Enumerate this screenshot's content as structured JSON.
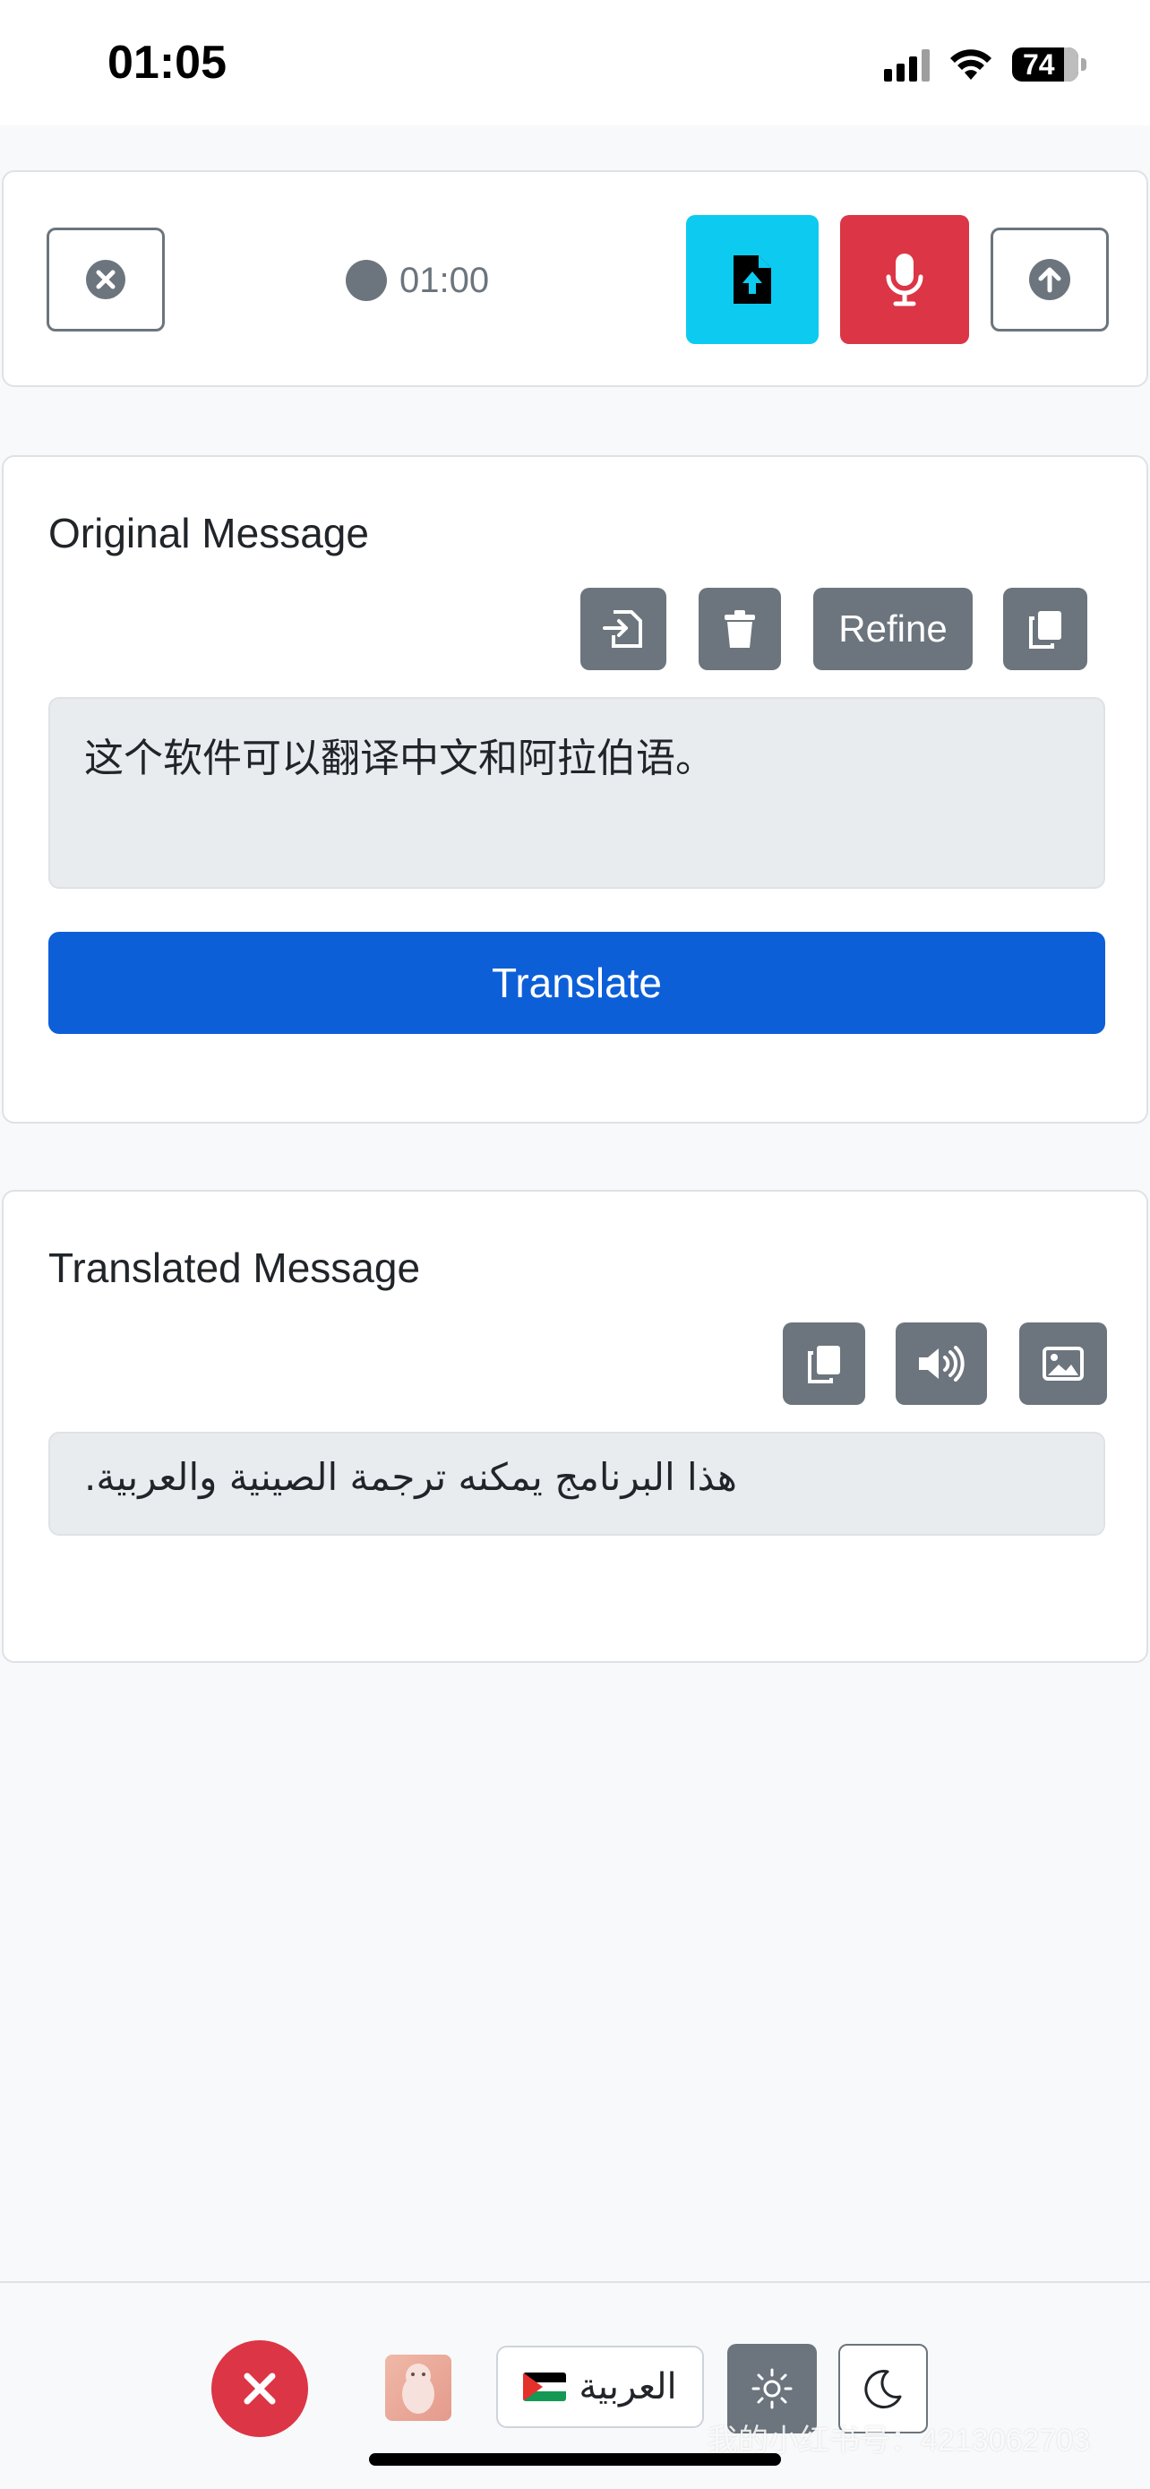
{
  "status_bar": {
    "time": "01:05",
    "battery": "74"
  },
  "recorder": {
    "timer": "01:00"
  },
  "original": {
    "title": "Original Message",
    "refine_label": "Refine",
    "text": "这个软件可以翻译中文和阿拉伯语。",
    "translate_label": "Translate"
  },
  "translated": {
    "title": "Translated Message",
    "text": "هذا البرنامج يمكنه ترجمة الصينية والعربية."
  },
  "bottom": {
    "language": "العربية"
  },
  "watermark": "我的小红书号：4213062703",
  "colors": {
    "primary": "#0d5fd8",
    "danger": "#dc3545",
    "info": "#0dcaf0",
    "secondary": "#6c757d"
  }
}
